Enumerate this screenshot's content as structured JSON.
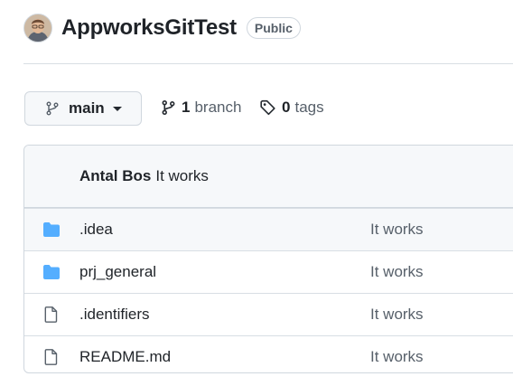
{
  "repo": {
    "name": "AppworksGitTest",
    "visibility": "Public"
  },
  "branch_selector": {
    "current": "main"
  },
  "branches_link": {
    "count": "1",
    "label": "branch"
  },
  "tags_link": {
    "count": "0",
    "label": "tags"
  },
  "latest_commit": {
    "author": "Antal Bos",
    "message": "It works"
  },
  "files": [
    {
      "name": ".idea",
      "type": "folder",
      "icon": "folder-icon",
      "commit_message": "It works"
    },
    {
      "name": "prj_general",
      "type": "folder",
      "icon": "folder-icon",
      "commit_message": "It works"
    },
    {
      "name": ".identifiers",
      "type": "file",
      "icon": "file-icon",
      "commit_message": "It works"
    },
    {
      "name": "README.md",
      "type": "file",
      "icon": "file-icon",
      "commit_message": "It works"
    }
  ],
  "colors": {
    "folder": "#54aeff",
    "muted_text": "#57606a",
    "border": "#d0d7de",
    "subtle_bg": "#f6f8fa"
  }
}
